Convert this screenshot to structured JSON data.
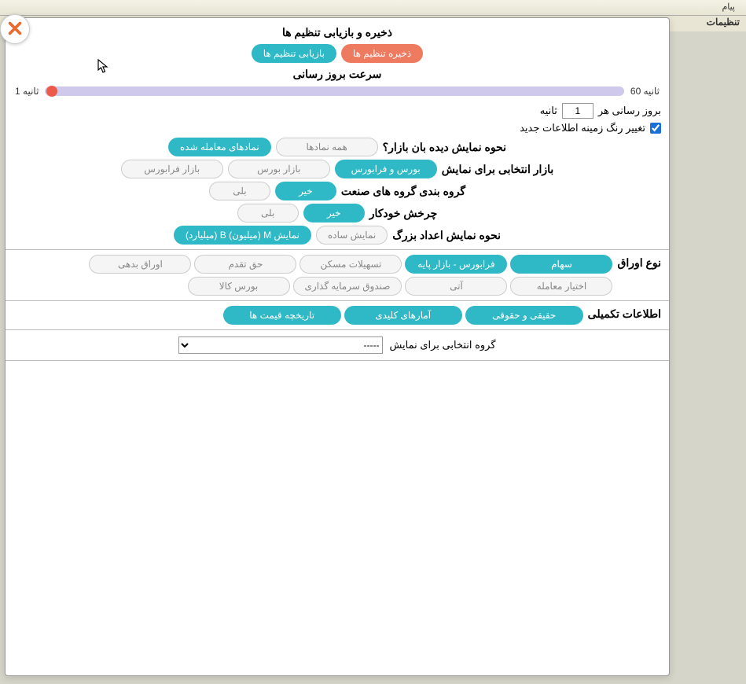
{
  "topbar": {
    "pager_label": "پیام"
  },
  "tab_title": "تنظیمات",
  "header": {
    "save_restore_title": "ذخیره و بازیابی تنظیم ها",
    "save_btn": "ذخیره تنظیم ها",
    "restore_btn": "بازیابی تنظیم ها"
  },
  "refresh": {
    "title": "سرعت بروز رسانی",
    "min_label": "ثانیه 60",
    "max_label": "ثانیه 1",
    "every_prefix": "بروز رسانی هر",
    "every_value": "1",
    "every_suffix": "ثانیه",
    "bg_color_change": "تغییر رنگ زمینه اطلاعات جدید",
    "bg_checked": true
  },
  "watchlist": {
    "label": "نحوه نمایش دیده بان بازار؟",
    "opt_all": "همه نمادها",
    "opt_traded": "نمادهای معامله شده"
  },
  "market": {
    "label": "بازار انتخابی برای نمایش",
    "opt_both": "بورس و فرابورس",
    "opt_bourse": "بازار بورس",
    "opt_fara": "بازار فرابورس"
  },
  "industry_group": {
    "label": "گروه بندی گروه های صنعت",
    "opt_no": "خیر",
    "opt_yes": "بلی"
  },
  "autorotate": {
    "label": "چرخش خودکار",
    "opt_no": "خیر",
    "opt_yes": "بلی"
  },
  "big_numbers": {
    "label": "نحوه نمایش اعداد بزرگ",
    "opt_simple": "نمایش ساده",
    "opt_mb": "نمایش M (میلیون) B (میلیارد)"
  },
  "paper_type": {
    "label": "نوع اوراق",
    "opts": [
      {
        "t": "سهام",
        "on": true
      },
      {
        "t": "فرابورس - بازار پایه",
        "on": true
      },
      {
        "t": "تسهیلات مسکن",
        "on": false
      },
      {
        "t": "حق تقدم",
        "on": false
      },
      {
        "t": "اوراق بدهی",
        "on": false
      },
      {
        "t": "اختیار معامله",
        "on": false
      },
      {
        "t": "آتی",
        "on": false
      },
      {
        "t": "صندوق سرمایه گذاری",
        "on": false
      },
      {
        "t": "بورس کالا",
        "on": false
      }
    ]
  },
  "extra_info": {
    "label": "اطلاعات تکمیلی",
    "opts": [
      {
        "t": "حقیقی و حقوقی",
        "on": true
      },
      {
        "t": "آمارهای کلیدی",
        "on": true
      },
      {
        "t": "تاریخچه قیمت ها",
        "on": true
      }
    ]
  },
  "group_select": {
    "label": "گروه انتخابی برای نمایش",
    "value": "-----"
  }
}
